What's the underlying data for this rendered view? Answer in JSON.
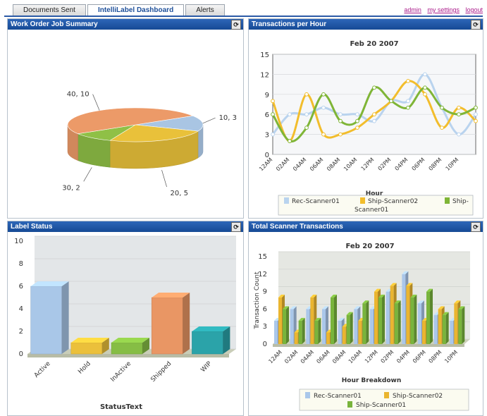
{
  "tabs": [
    "Documents Sent",
    "IntelliLabel Dashboard",
    "Alerts"
  ],
  "links": {
    "admin": "admin",
    "settings": "my settings",
    "logout": "logout"
  },
  "icons": {
    "refresh": "refresh-icon"
  },
  "colors": {
    "rec": "#9ec0e4",
    "ship02": "#f2bd2c",
    "ship01": "#7fb537",
    "header": "#1f56a8"
  },
  "panels": {
    "work_order": {
      "title": "Work Order Job Summary"
    },
    "transactions": {
      "title": "Transactions per Hour"
    },
    "label_status": {
      "title": "Label Status"
    },
    "scanner": {
      "title": "Total Scanner Transactions"
    }
  },
  "chart_data": [
    {
      "type": "pie",
      "title": "",
      "slices": [
        {
          "label": "10, 3",
          "value": 3,
          "color": "#a9c5e3"
        },
        {
          "label": "20, 5",
          "value": 5,
          "color": "#e9c13a"
        },
        {
          "label": "30, 2",
          "value": 2,
          "color": "#8fc046"
        },
        {
          "label": "40, 10",
          "value": 10,
          "color": "#ec9a68"
        }
      ]
    },
    {
      "type": "line",
      "title": "Feb 20 2007",
      "xlabel": "Hour",
      "ylabel": "",
      "ylim": [
        0,
        15
      ],
      "yticks": [
        0,
        3,
        6,
        9,
        12,
        15
      ],
      "categories": [
        "12AM",
        "02AM",
        "04AM",
        "06AM",
        "08AM",
        "10AM",
        "12PM",
        "02PM",
        "04PM",
        "06PM",
        "08PM",
        "10PM"
      ],
      "series": [
        {
          "name": "Rec-Scanner01",
          "color": "#b9d3ee",
          "values": [
            3,
            6,
            6,
            7,
            6,
            6,
            5,
            8,
            8,
            12,
            7,
            3,
            6
          ]
        },
        {
          "name": "Ship-Scanner02",
          "color": "#f2bd2c",
          "values": [
            8,
            2,
            9,
            3,
            3,
            4,
            6,
            8,
            11,
            9,
            4,
            7,
            5
          ]
        },
        {
          "name": "Ship-Scanner01",
          "color": "#7fb537",
          "values": [
            6,
            2,
            4,
            9,
            5,
            5,
            10,
            8,
            7,
            10,
            7,
            6,
            7
          ]
        }
      ],
      "legend": "bottom"
    },
    {
      "type": "bar",
      "title": "",
      "xlabel": "StatusText",
      "ylabel": "",
      "ylim": [
        0,
        10
      ],
      "yticks": [
        0,
        2,
        4,
        6,
        8,
        10
      ],
      "categories": [
        "Active",
        "Hold",
        "InActive",
        "Shipped",
        "WIP"
      ],
      "values": [
        6,
        1,
        1,
        5,
        2
      ],
      "colors": [
        "#a9c7e8",
        "#ebc03b",
        "#86bd45",
        "#e99664",
        "#2ba3a9"
      ]
    },
    {
      "type": "bar",
      "title": "Feb 20 2007",
      "xlabel": "Hour Breakdown",
      "ylabel": "Transaction Count",
      "ylim": [
        0,
        15
      ],
      "yticks": [
        0,
        3,
        6,
        9,
        12,
        15
      ],
      "categories": [
        "12AM",
        "02AM",
        "04AM",
        "06AM",
        "08AM",
        "10AM",
        "12PM",
        "02PM",
        "04PM",
        "06PM",
        "08PM",
        "10PM"
      ],
      "series": [
        {
          "name": "Rec-Scanner01",
          "color": "#aac7ea",
          "values": [
            4,
            6,
            6,
            6,
            4,
            6,
            6,
            9,
            12,
            7,
            5,
            4
          ]
        },
        {
          "name": "Ship-Scanner02",
          "color": "#eab530",
          "values": [
            8,
            2,
            8,
            2,
            3,
            4,
            9,
            10,
            10,
            4,
            6,
            7
          ]
        },
        {
          "name": "Ship-Scanner01",
          "color": "#79b43c",
          "values": [
            6,
            4,
            4,
            8,
            5,
            7,
            8,
            7,
            8,
            9,
            5,
            6
          ]
        }
      ],
      "legend": "bottom"
    }
  ]
}
